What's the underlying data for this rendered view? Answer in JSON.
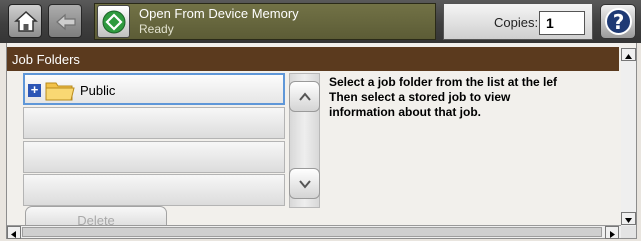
{
  "header": {
    "title": "Open From Device Memory",
    "status": "Ready",
    "copies_label": "Copies:",
    "copies_value": "1",
    "help_glyph": "?"
  },
  "section": {
    "title": "Job Folders"
  },
  "folders": {
    "expand_glyph": "+",
    "items": [
      "Public",
      "",
      "",
      ""
    ]
  },
  "instructions": "Select a job folder from the list at the lef\nThen select a stored job to view\ninformation about that job.",
  "buttons": {
    "delete_label": "Delete"
  },
  "icons": {
    "home": "home-icon",
    "back": "back-arrow-icon",
    "start": "start-icon",
    "folder": "folder-icon",
    "scroll_up": "chevron-up-icon",
    "scroll_down": "chevron-down-icon",
    "help": "help-icon"
  },
  "colors": {
    "header_bar": "#3f3f3f",
    "title_panel": "#5c5c36",
    "section_header": "#5b3a1e",
    "start_green": "#2e9a3e",
    "selection_border": "#5f97d8",
    "help_blue": "#1f3a74"
  }
}
